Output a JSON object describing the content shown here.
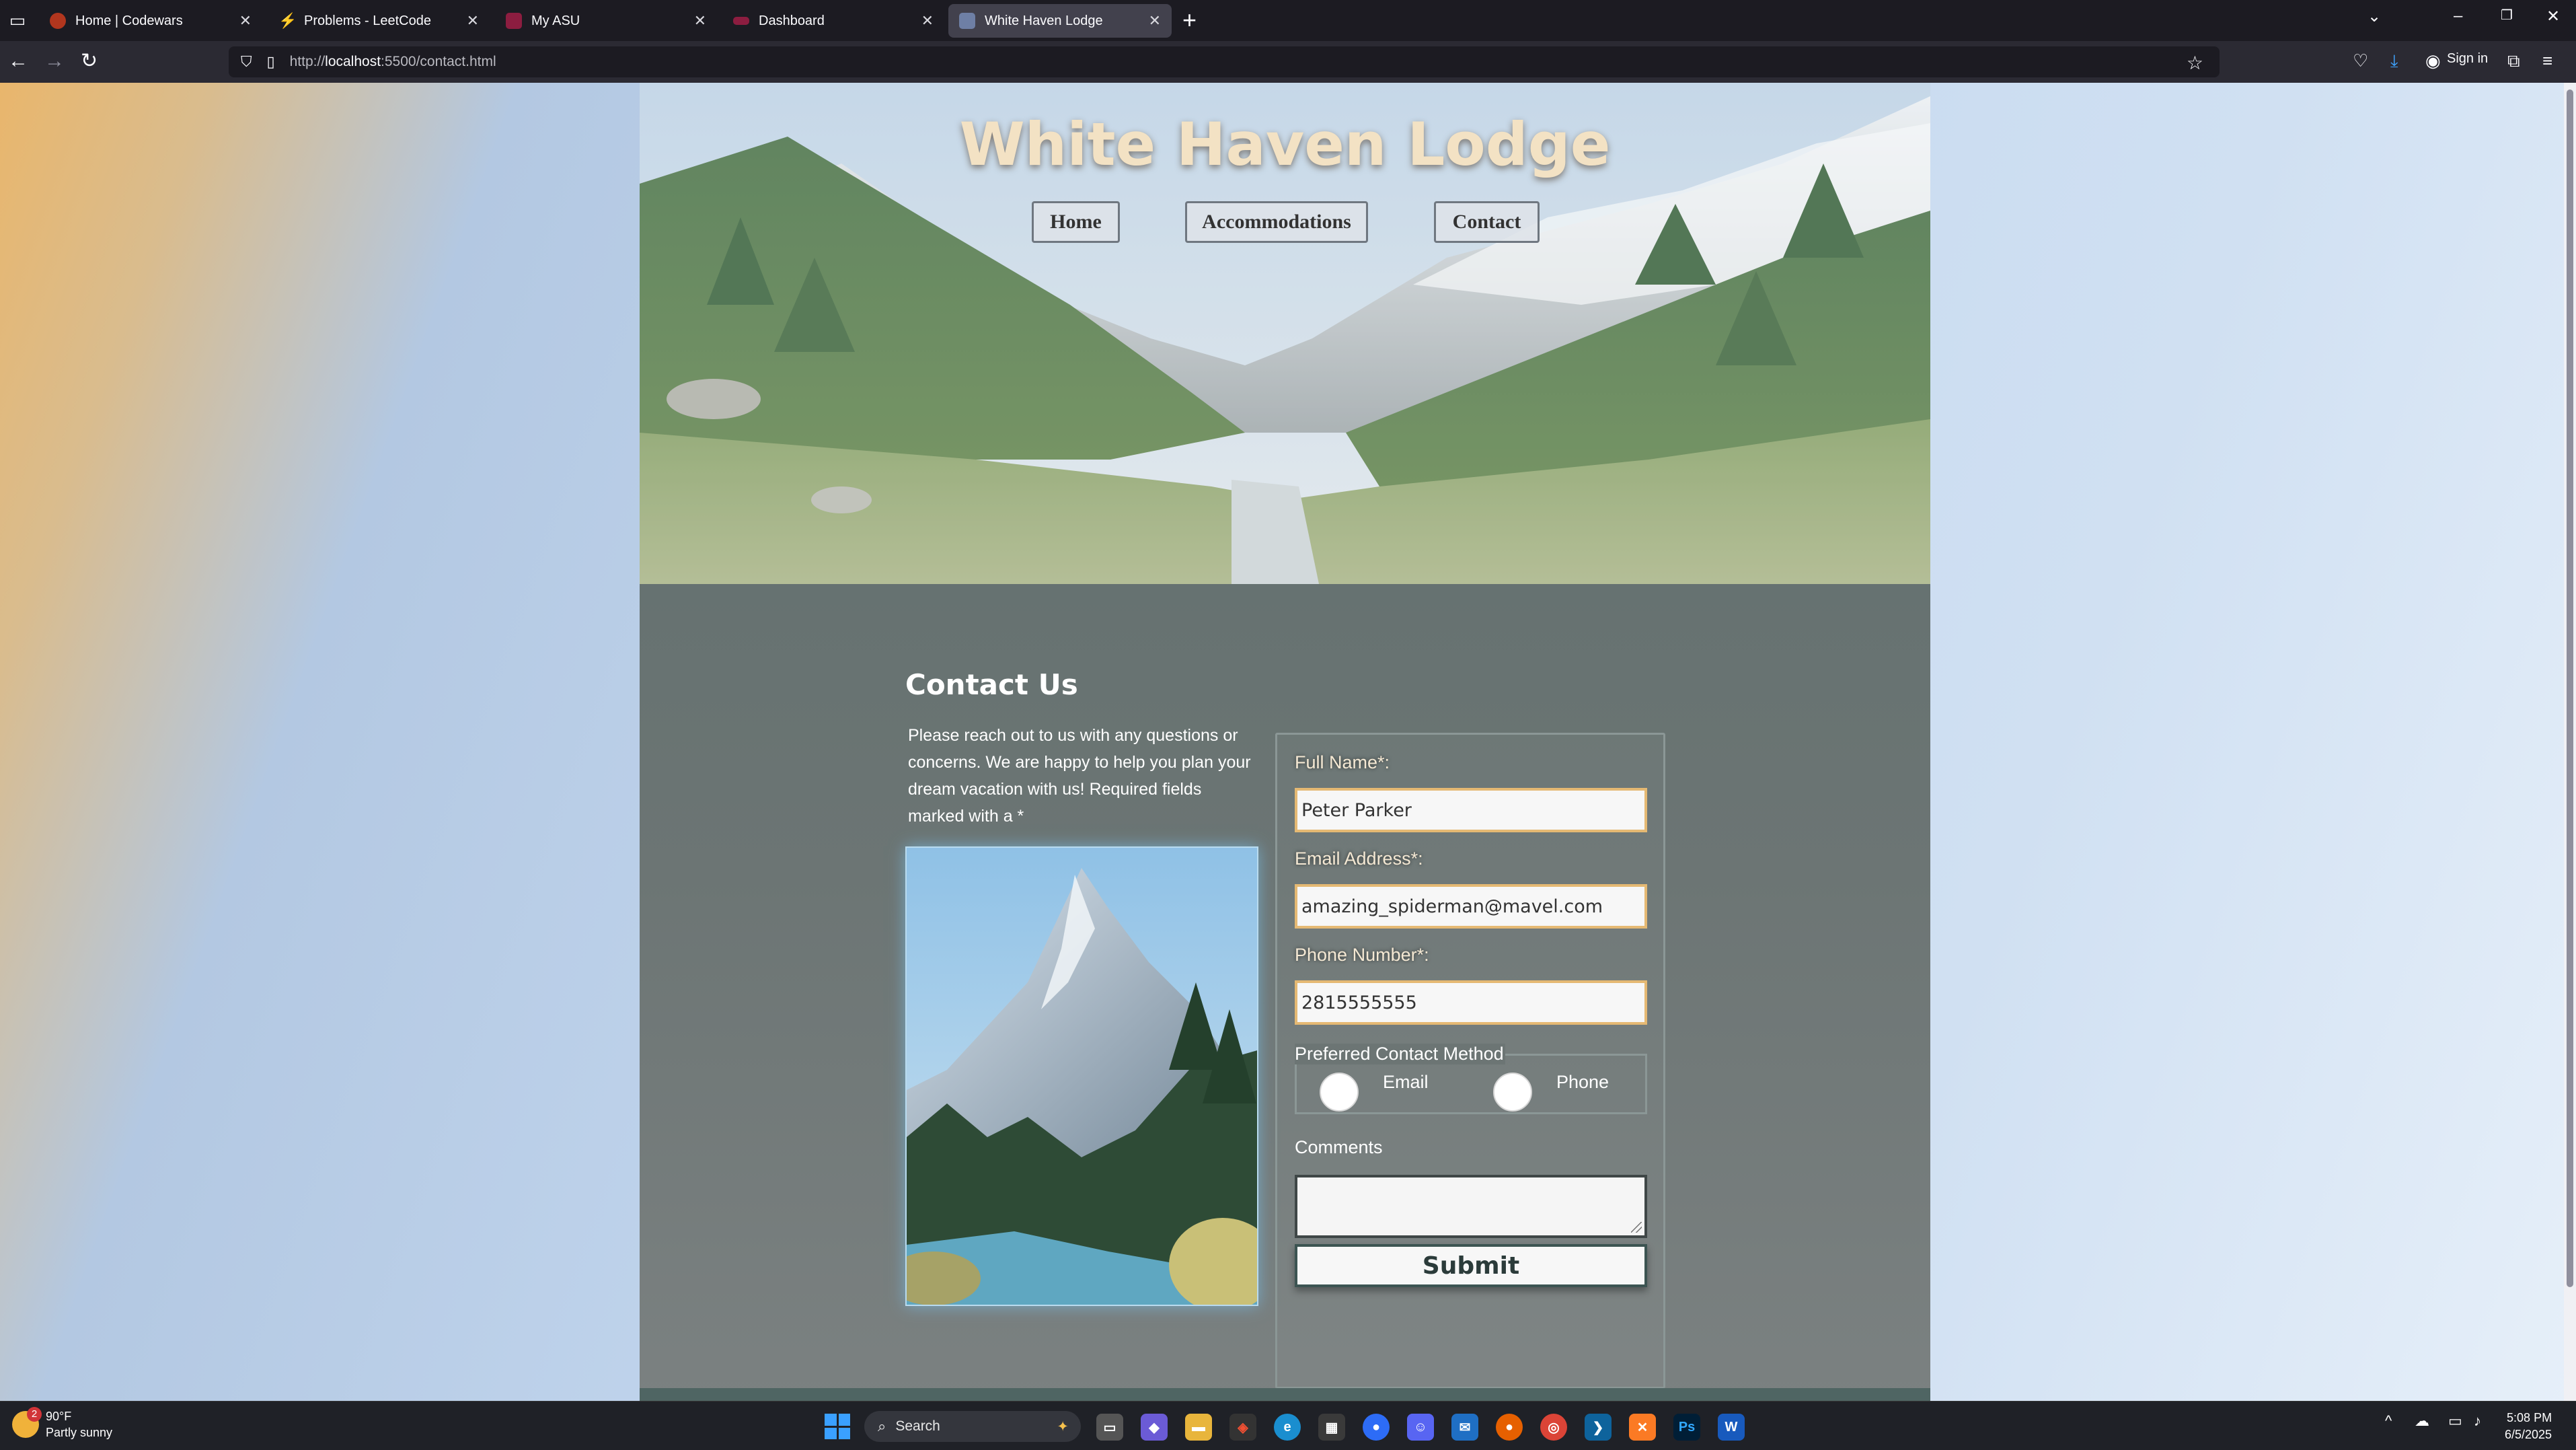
{
  "browser": {
    "tabs": [
      {
        "label": "Home | Codewars",
        "icon": "codewars-icon",
        "color": "#b1361e",
        "active": false
      },
      {
        "label": "Problems - LeetCode",
        "icon": "leetcode-icon",
        "color": "#f89f1b",
        "active": false
      },
      {
        "label": "My ASU",
        "icon": "asu-icon",
        "color": "#8c1d40",
        "active": false
      },
      {
        "label": "Dashboard",
        "icon": "dashboard-icon",
        "color": "#8c1d40",
        "active": false
      },
      {
        "label": "White Haven Lodge",
        "icon": "vscode-live-icon",
        "color": "#6e7fa5",
        "active": true
      }
    ],
    "url_prefix": "http://",
    "url_host": "localhost",
    "url_rest": ":5500/contact.html",
    "sign_in_label": "Sign in"
  },
  "site": {
    "title": "White Haven Lodge",
    "nav": [
      {
        "label": "Home"
      },
      {
        "label": "Accommodations"
      },
      {
        "label": "Contact"
      }
    ]
  },
  "contact": {
    "heading": "Contact Us",
    "intro": "Please reach out to us with any questions or concerns. We are happy to help you plan your dream vacation with us! Required fields marked with a *",
    "form": {
      "full_name_label": "Full Name*:",
      "full_name_value": "Peter Parker",
      "email_label": "Email Address*:",
      "email_value": "amazing_spiderman@mavel.com",
      "phone_label": "Phone Number*:",
      "phone_value": "2815555555",
      "contact_method_legend": "Preferred Contact Method",
      "contact_options": [
        {
          "label": "Email",
          "checked": false
        },
        {
          "label": "Phone",
          "checked": false
        }
      ],
      "comments_label": "Comments",
      "comments_value": "",
      "submit_label": "Submit"
    }
  },
  "taskbar": {
    "weather_temp": "90°F",
    "weather_desc": "Partly sunny",
    "weather_badge": "2",
    "search_label": "Search",
    "time": "5:08 PM",
    "date": "6/5/2025",
    "apps": [
      "task-view-icon",
      "copilot-icon",
      "file-explorer-icon",
      "git-icon",
      "edge-icon",
      "store-icon",
      "zoom-icon",
      "discord-icon",
      "outlook-icon",
      "firefox-icon",
      "chrome-icon",
      "vscode-icon",
      "xampp-icon",
      "photoshop-icon",
      "word-icon"
    ]
  }
}
